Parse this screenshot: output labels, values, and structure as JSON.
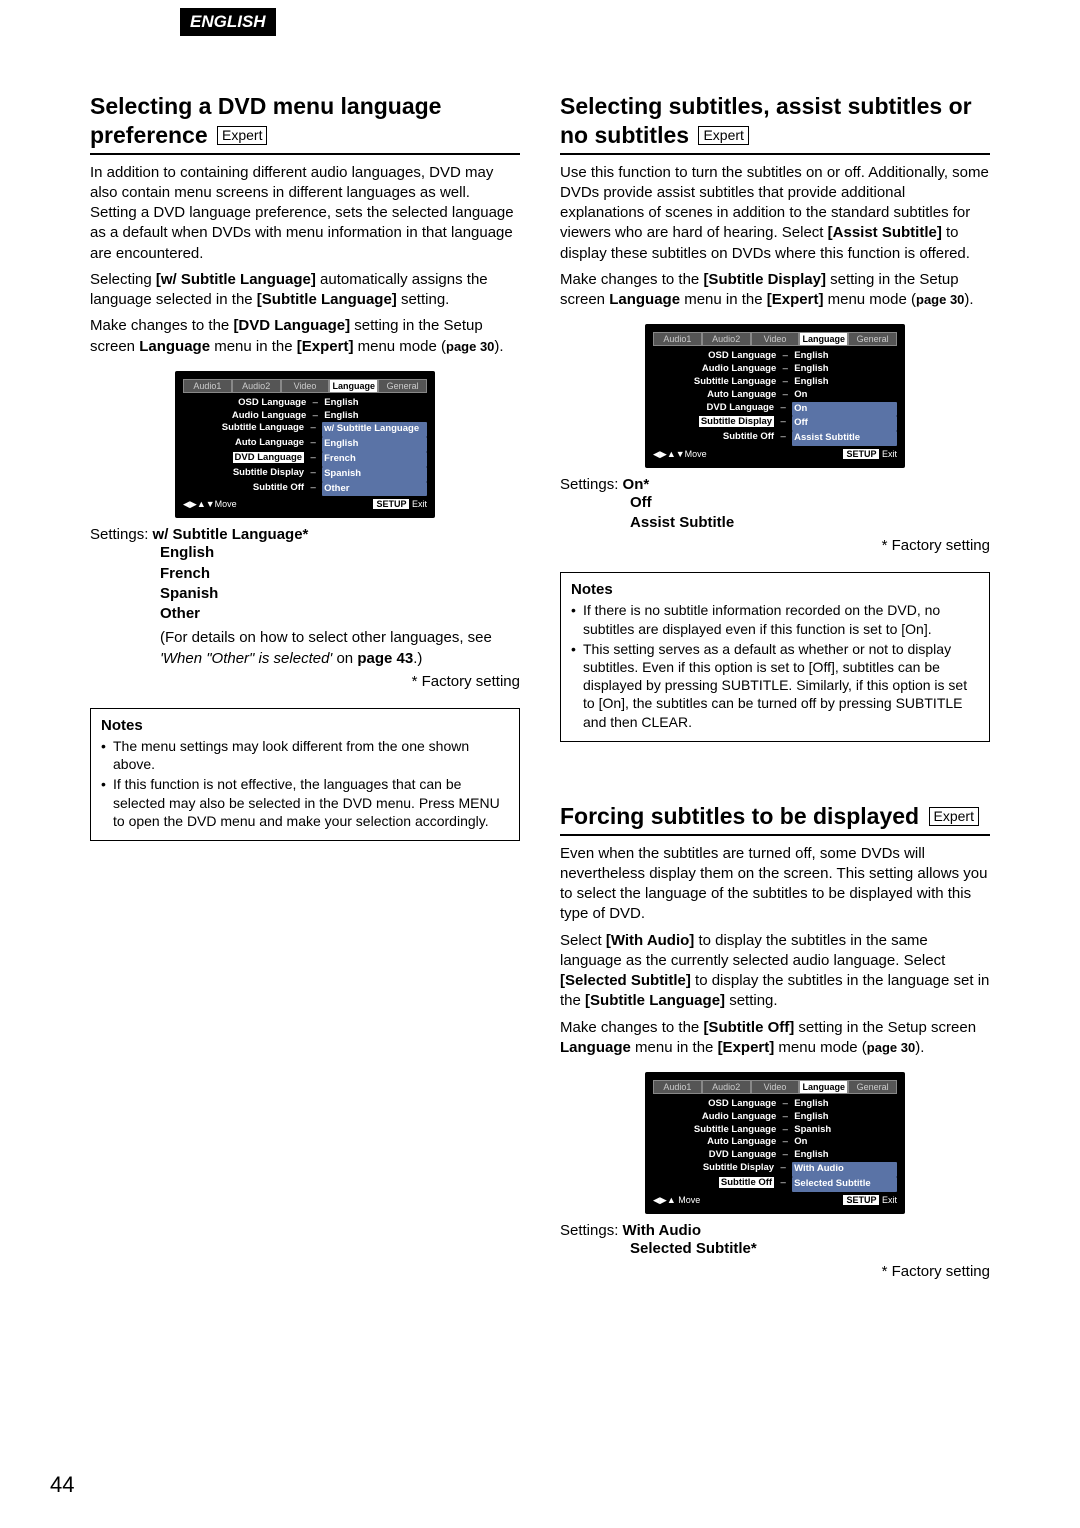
{
  "langBadge": "ENGLISH",
  "expertLabel": "Expert",
  "pageNumber": "44",
  "factoryNote": "* Factory setting",
  "settingsLabel": "Settings:",
  "notesHeading": "Notes",
  "osd": {
    "tabs": [
      "Audio1",
      "Audio2",
      "Video",
      "Language",
      "General"
    ],
    "footerLeft": "◀▶▲▼Move",
    "footerLeft2": "◀▶▲ Move",
    "footerSetup": "SETUP",
    "footerExit": "Exit"
  },
  "sec1": {
    "title1": "Selecting a DVD menu language",
    "title2": "preference",
    "p1": "In addition to containing different audio languages, DVD may also contain menu screens in different languages as well. Setting a DVD language preference, sets the selected language as a default when DVDs with menu information in that language are encountered.",
    "p2a": "Selecting ",
    "p2b": "[w/ Subtitle Language]",
    "p2c": " automatically assigns the language selected in the ",
    "p2d": "[Subtitle Language]",
    "p2e": " setting.",
    "p3a": "Make changes to the ",
    "p3b": "[DVD Language]",
    "p3c": " setting in the Setup screen ",
    "p3d": "Language",
    "p3e": " menu in the ",
    "p3f": "[Expert]",
    "p3g": " menu mode (",
    "pageRef": "page 30",
    "p3h": ").",
    "osdRows": [
      {
        "k": "OSD Language",
        "v": "English"
      },
      {
        "k": "Audio Language",
        "v": "English"
      },
      {
        "k": "Subtitle Language",
        "v": "w/ Subtitle Language",
        "popup": true
      },
      {
        "k": "Auto Language",
        "v": "English",
        "popup": true
      },
      {
        "k": "DVD Language",
        "v": "French",
        "selected": true,
        "popup": true
      },
      {
        "k": "Subtitle Display",
        "v": "Spanish",
        "popup": true
      },
      {
        "k": "Subtitle Off",
        "v": "Other",
        "popup": true
      }
    ],
    "settings": [
      "w/ Subtitle Language*",
      "English",
      "French",
      "Spanish",
      "Other"
    ],
    "detail1": "(For details on how to select other languages, see ",
    "detail2": "'When \"Other\" is selected'",
    "detail3": " on ",
    "detailPage": "page 43",
    "detail4": ".)",
    "notes": [
      "The menu settings may look different from the one shown above.",
      "If this function is not effective, the languages that can be selected may also be selected in the DVD menu. Press MENU to open the DVD menu and make your selection accordingly."
    ]
  },
  "sec2": {
    "title1": "Selecting subtitles, assist subtitles or",
    "title2": "no subtitles",
    "p1a": "Use this function to turn the subtitles on or off. Additionally, some DVDs provide assist subtitles that provide additional explanations of scenes in addition to the standard subtitles for viewers who are hard of hearing. Select ",
    "p1b": "[Assist Subtitle]",
    "p1c": " to display these subtitles on DVDs where this function is offered.",
    "p2a": "Make changes to the ",
    "p2b": "[Subtitle Display]",
    "p2c": " setting in the Setup screen ",
    "p2d": "Language",
    "p2e": " menu in the ",
    "p2f": "[Expert]",
    "p2g": " menu mode (",
    "pageRef": "page 30",
    "p2h": ").",
    "osdRows": [
      {
        "k": "OSD Language",
        "v": "English"
      },
      {
        "k": "Audio Language",
        "v": "English"
      },
      {
        "k": "Subtitle Language",
        "v": "English"
      },
      {
        "k": "Auto Language",
        "v": "On"
      },
      {
        "k": "DVD Language",
        "v": "On",
        "popup": true
      },
      {
        "k": "Subtitle Display",
        "v": "Off",
        "selected": true,
        "popup": true
      },
      {
        "k": "Subtitle Off",
        "v": "Assist Subtitle",
        "popup": true
      }
    ],
    "settings": [
      "On*",
      "Off",
      "Assist Subtitle"
    ],
    "notes": [
      "If there is no subtitle information recorded on the DVD, no subtitles are displayed even if this function is set to [On].",
      "This setting serves as a default as whether or not to display subtitles. Even if this option is set to [Off], subtitles can be displayed by pressing SUBTITLE. Similarly, if this option is set to [On], the subtitles can be turned off by pressing SUBTITLE and then CLEAR."
    ]
  },
  "sec3": {
    "title": "Forcing subtitles to be displayed",
    "p1": "Even when the subtitles are turned off, some DVDs will nevertheless display them on the screen. This setting allows you to select the language of the subtitles to be displayed with this type of DVD.",
    "p2a": "Select ",
    "p2b": "[With Audio]",
    "p2c": " to display the subtitles in the same language as the currently selected audio language. Select ",
    "p2d": "[Selected Subtitle]",
    "p2e": " to display the subtitles in the language set in the ",
    "p2f": "[Subtitle Language]",
    "p2g": " setting.",
    "p3a": "Make changes to the ",
    "p3b": "[Subtitle Off]",
    "p3c": " setting in the Setup screen ",
    "p3d": "Language",
    "p3e": " menu in the ",
    "p3f": "[Expert]",
    "p3g": " menu mode (",
    "pageRef": "page 30",
    "p3h": ").",
    "osdRows": [
      {
        "k": "OSD Language",
        "v": "English"
      },
      {
        "k": "Audio Language",
        "v": "English"
      },
      {
        "k": "Subtitle Language",
        "v": "Spanish"
      },
      {
        "k": "Auto Language",
        "v": "On"
      },
      {
        "k": "DVD Language",
        "v": "English"
      },
      {
        "k": "Subtitle Display",
        "v": "With Audio",
        "popup": true
      },
      {
        "k": "Subtitle Off",
        "v": "Selected Subtitle",
        "selected": true,
        "popup": true
      }
    ],
    "settings": [
      "With Audio",
      "Selected Subtitle*"
    ]
  }
}
